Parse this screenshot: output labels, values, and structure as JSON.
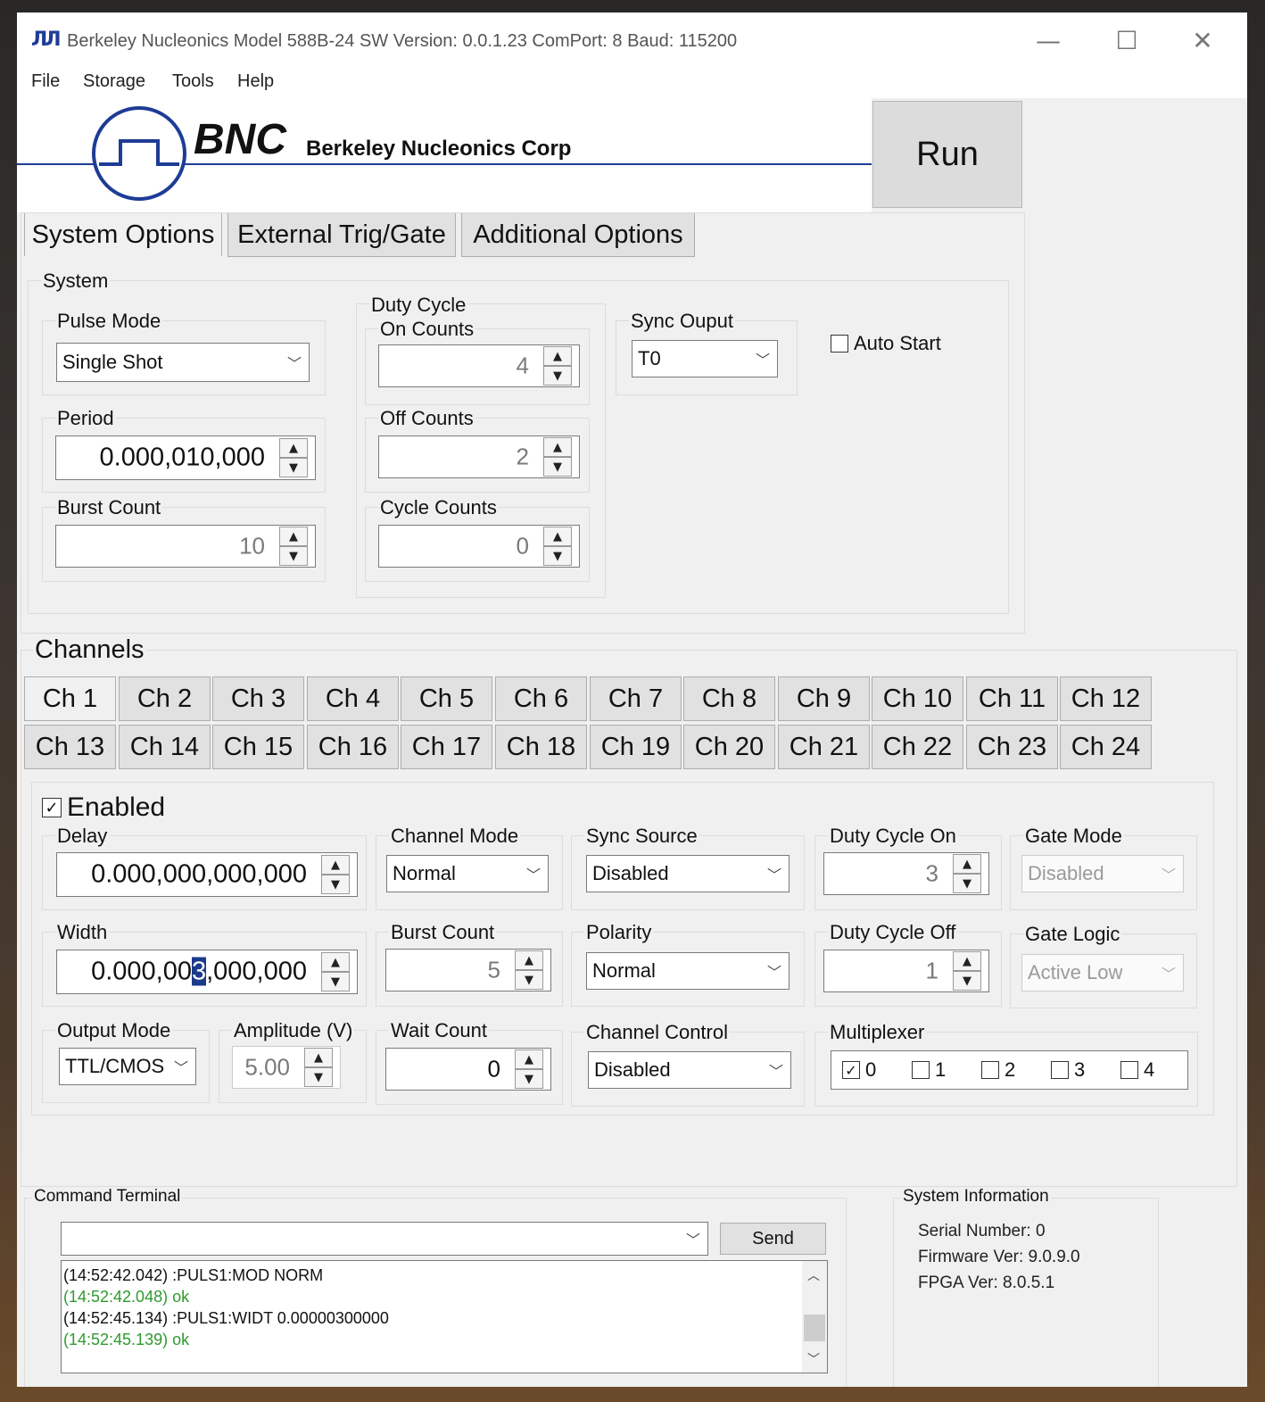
{
  "window": {
    "title": "Berkeley Nucleonics Model 588B-24  SW Version: 0.0.1.23 ComPort: 8 Baud: 115200",
    "app_icon": "ЛЛ",
    "controls": {
      "minimize": "—",
      "maximize": "☐",
      "close": "✕"
    }
  },
  "menu": [
    "File",
    "Storage",
    "Tools",
    "Help"
  ],
  "banner": {
    "logo_text": "BNC",
    "company": "Berkeley Nucleonics Corp"
  },
  "run_label": "Run",
  "tabs": [
    "System Options",
    "External Trig/Gate",
    "Additional Options"
  ],
  "system": {
    "group_label": "System",
    "pulse_mode": {
      "label": "Pulse Mode",
      "value": "Single Shot"
    },
    "period": {
      "label": "Period",
      "value": "0.000,010,000"
    },
    "burst_count": {
      "label": "Burst Count",
      "value": "10"
    },
    "duty_cycle": {
      "label": "Duty Cycle",
      "on_counts": {
        "label": "On Counts",
        "value": "4"
      },
      "off_counts": {
        "label": "Off Counts",
        "value": "2"
      },
      "cycle_counts": {
        "label": "Cycle Counts",
        "value": "0"
      }
    },
    "sync_output": {
      "label": "Sync Ouput",
      "value": "T0"
    },
    "auto_start": {
      "label": "Auto Start",
      "checked": false
    }
  },
  "channels": {
    "heading": "Channels",
    "tabs": [
      "Ch 1",
      "Ch 2",
      "Ch 3",
      "Ch 4",
      "Ch 5",
      "Ch 6",
      "Ch 7",
      "Ch 8",
      "Ch 9",
      "Ch 10",
      "Ch 11",
      "Ch 12",
      "Ch 13",
      "Ch 14",
      "Ch 15",
      "Ch 16",
      "Ch 17",
      "Ch 18",
      "Ch 19",
      "Ch 20",
      "Ch 21",
      "Ch 22",
      "Ch 23",
      "Ch 24"
    ],
    "active": "Ch 1"
  },
  "channel": {
    "enabled": {
      "label": "Enabled",
      "checked": true
    },
    "delay": {
      "label": "Delay",
      "value": "0.000,000,000,000"
    },
    "width": {
      "label": "Width",
      "value_before": "0.000,00",
      "value_sel": "3",
      "value_after": ",000,000"
    },
    "channel_mode": {
      "label": "Channel Mode",
      "value": "Normal"
    },
    "sync_source": {
      "label": "Sync Source",
      "value": "Disabled"
    },
    "duty_cycle_on": {
      "label": "Duty Cycle On",
      "value": "3"
    },
    "gate_mode": {
      "label": "Gate Mode",
      "value": "Disabled"
    },
    "burst_count": {
      "label": "Burst Count",
      "value": "5"
    },
    "polarity": {
      "label": "Polarity",
      "value": "Normal"
    },
    "duty_cycle_off": {
      "label": "Duty Cycle Off",
      "value": "1"
    },
    "gate_logic": {
      "label": "Gate Logic",
      "value": "Active Low"
    },
    "output_mode": {
      "label": "Output Mode",
      "value": "TTL/CMOS"
    },
    "amplitude": {
      "label": "Amplitude (V)",
      "value": "5.00"
    },
    "wait_count": {
      "label": "Wait Count",
      "value": "0"
    },
    "channel_control": {
      "label": "Channel Control",
      "value": "Disabled"
    },
    "multiplexer": {
      "label": "Multiplexer",
      "items": [
        {
          "label": "0",
          "checked": true
        },
        {
          "label": "1",
          "checked": false
        },
        {
          "label": "2",
          "checked": false
        },
        {
          "label": "3",
          "checked": false
        },
        {
          "label": "4",
          "checked": false
        }
      ]
    }
  },
  "terminal": {
    "label": "Command Terminal",
    "input_value": "",
    "send_label": "Send",
    "log": [
      {
        "text": "(14:52:42.042) :PULS1:MOD NORM",
        "color": "#111111"
      },
      {
        "text": "(14:52:42.048) ok",
        "color": "#2e9a2e"
      },
      {
        "text": "(14:52:45.134) :PULS1:WIDT 0.00000300000",
        "color": "#111111"
      },
      {
        "text": "(14:52:45.139) ok",
        "color": "#2e9a2e"
      }
    ]
  },
  "system_info": {
    "label": "System Information",
    "serial": "Serial Number: 0",
    "firmware": "Firmware Ver: 9.0.9.0",
    "fpga": "FPGA Ver: 8.0.5.1"
  },
  "colors": {
    "accent": "#1e3c96",
    "window_bg": "#f0f0f0",
    "ok_green": "#2e9a2e",
    "selection": "#1c3a8a"
  }
}
